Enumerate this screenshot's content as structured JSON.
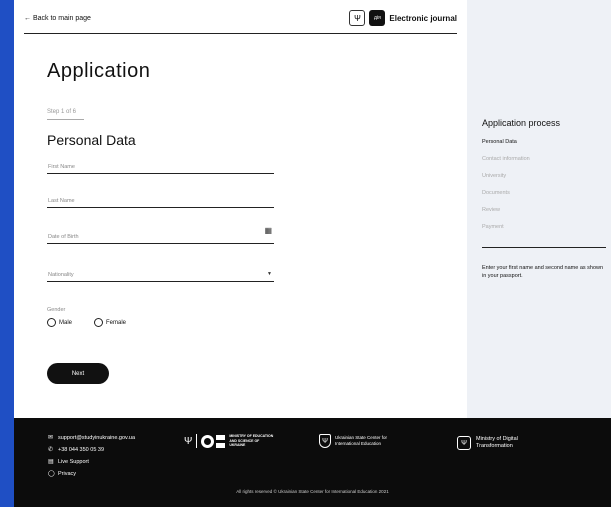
{
  "header": {
    "back_label": "← Back to main page",
    "diia_badge": "дія",
    "title": "Electronic journal"
  },
  "form": {
    "title": "Application",
    "step": "Step 1 of 6",
    "section_title": "Personal Data",
    "fields": {
      "first_name": "First Name",
      "last_name": "Last Name",
      "dob": "Date of Birth",
      "nationality": "Nationality"
    },
    "gender": {
      "label": "Gender",
      "male": "Male",
      "female": "Female"
    },
    "next_label": "Next"
  },
  "sidebar": {
    "title": "Application process",
    "items": [
      "Personal Data",
      "Contact information",
      "University",
      "Documents",
      "Review",
      "Payment"
    ],
    "note": "Enter your first name and second name as shown in your passport."
  },
  "footer": {
    "email": "support@studyinukraine.gov.ua",
    "phone": "+38 044 350 05 39",
    "live_support": "Live Support",
    "privacy": "Privacy",
    "mes": "MINISTRY OF EDUCATION AND SCIENCE OF UKRAINE",
    "center": "Ukrainian State Center for International Education",
    "mdt": "Ministry of Digital Transformation",
    "copyright": "All rights reserved © Ukrainian State Center for International Education 2021"
  },
  "colors": {
    "accent": "#1f4fc4",
    "sidebar_bg": "#eef1f6",
    "footer_bg": "#0c0c0c"
  },
  "icons": [
    "trident-icon",
    "calendar-icon",
    "chevron-down-icon",
    "mail-icon",
    "phone-icon",
    "chat-icon",
    "shield-icon"
  ]
}
